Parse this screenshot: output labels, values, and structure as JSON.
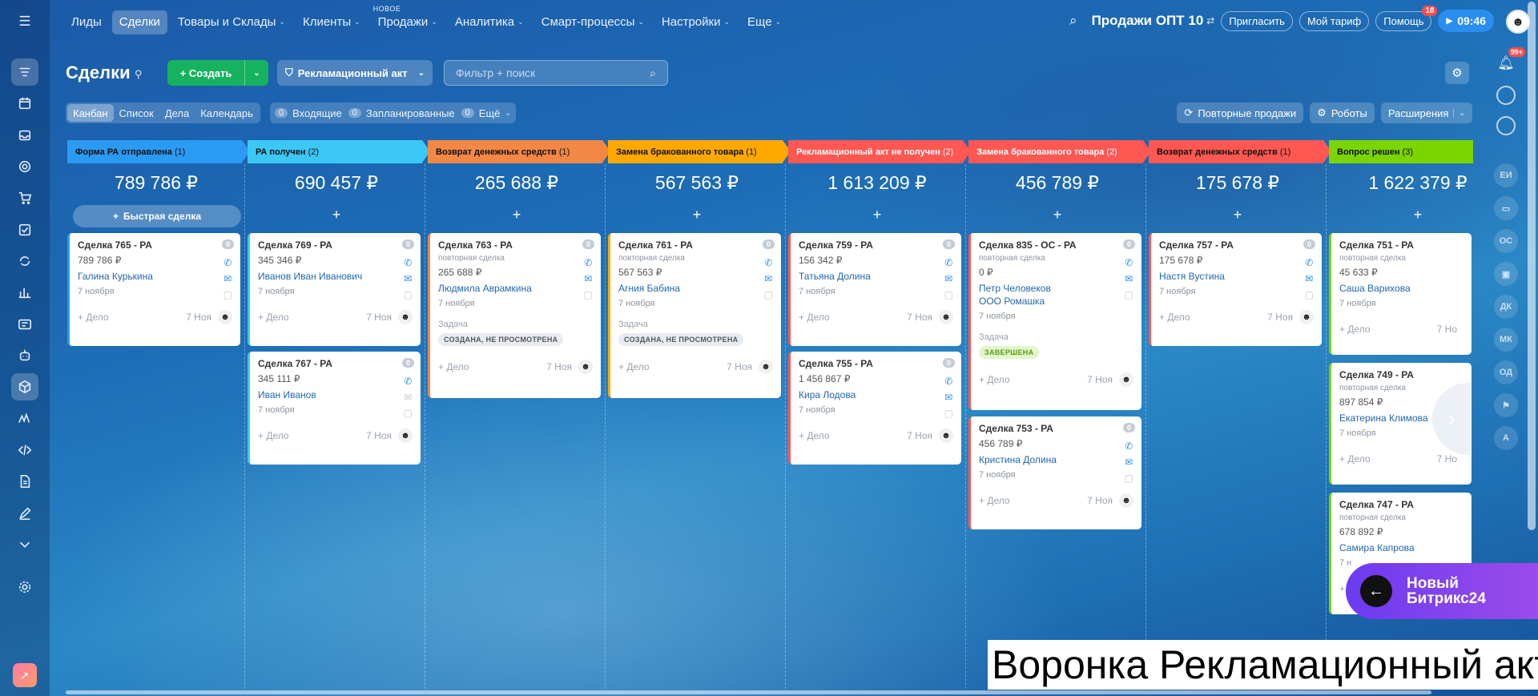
{
  "topnav": {
    "items": [
      {
        "label": "Лиды",
        "active": false,
        "chev": ""
      },
      {
        "label": "Сделки",
        "active": true,
        "chev": ""
      },
      {
        "label": "Товары и Склады",
        "active": false,
        "chev": "⌄"
      },
      {
        "label": "Клиенты",
        "active": false,
        "chev": "⌄"
      },
      {
        "label": "Продажи",
        "active": false,
        "chev": "⌄",
        "tag": "НОВОЕ"
      },
      {
        "label": "Аналитика",
        "active": false,
        "chev": "⌄"
      },
      {
        "label": "Смарт-процессы",
        "active": false,
        "chev": "⌄"
      },
      {
        "label": "Настройки",
        "active": false,
        "chev": "⌄"
      },
      {
        "label": "Еще",
        "active": false,
        "chev": "⌄"
      }
    ],
    "portal_name": "Продажи ОПТ 10",
    "invite_label": "Пригласить",
    "tariff_label": "Мой тариф",
    "help_label": "Помощь",
    "help_badge": "18",
    "time": "09:46"
  },
  "toolbar": {
    "title": "Сделки",
    "create_label": "Создать",
    "funnel_label": "Рекламационный акт",
    "search_placeholder": "Фильтр + поиск"
  },
  "views": {
    "tabs": [
      "Канбан",
      "Список",
      "Дела",
      "Календарь"
    ],
    "counters": [
      {
        "num": "0",
        "label": "Входящие"
      },
      {
        "num": "0",
        "label": "Запланированные"
      },
      {
        "num": "0",
        "label": "Ещё"
      }
    ],
    "repeat_sales": "Повторные продажи",
    "robots": "Роботы",
    "extensions": "Расширения"
  },
  "quick_deal_label": "Быстрая сделка",
  "stages": [
    {
      "name": "Форма РА отправлена",
      "count": "(1)",
      "sum": "789 786 ₽",
      "color": "#2b9af3",
      "text": "#111"
    },
    {
      "name": "РА получен",
      "count": "(2)",
      "sum": "690 457 ₽",
      "color": "#3bc8f5",
      "text": "#111"
    },
    {
      "name": "Возврат денежных средств",
      "count": "(1)",
      "sum": "265 688 ₽",
      "color": "#f28746",
      "text": "#111"
    },
    {
      "name": "Замена бракованного товара",
      "count": "(1)",
      "sum": "567 563 ₽",
      "color": "#ffa900",
      "text": "#111"
    },
    {
      "name": "Рекламационный акт не получен",
      "count": "(2)",
      "sum": "1 613 209 ₽",
      "color": "#ff5752",
      "text": "#fff"
    },
    {
      "name": "Замена бракованного товара",
      "count": "(2)",
      "sum": "456 789 ₽",
      "color": "#ff5752",
      "text": "#fff"
    },
    {
      "name": "Возврат денежных средств",
      "count": "(1)",
      "sum": "175 678 ₽",
      "color": "#ff5752",
      "text": "#111"
    },
    {
      "name": "Вопрос решен",
      "count": "(3)",
      "sum": "1 622 379 ₽",
      "color": "#7bd500",
      "text": "#111"
    }
  ],
  "cards": [
    {
      "title": "Сделка 765 - РА",
      "sub": "",
      "amount": "789 786 ₽",
      "contacts": [
        "Галина Курькина"
      ],
      "date": "7 ноября",
      "task_label": "",
      "task": "",
      "add": "+ Дело",
      "fdate": "7 Ноя",
      "badge": "0"
    },
    {
      "title": "Сделка 769 - РА",
      "sub": "",
      "amount": "345 346 ₽",
      "contacts": [
        "Иванов Иван Иванович"
      ],
      "date": "7 ноября",
      "task_label": "",
      "task": "",
      "add": "+ Дело",
      "fdate": "7 Ноя",
      "badge": "0"
    },
    {
      "title": "Сделка 767 - РА",
      "sub": "",
      "amount": "345 111 ₽",
      "contacts": [
        "Иван Иванов"
      ],
      "date": "7 ноября",
      "task_label": "",
      "task": "",
      "add": "+ Дело",
      "fdate": "7 Ноя",
      "badge": "0"
    },
    {
      "title": "Сделка 763 - РА",
      "sub": "повторная сделка",
      "amount": "265 688 ₽",
      "contacts": [
        "Людмила Аврамкина"
      ],
      "date": "7 ноября",
      "task_label": "Задача",
      "task": "СОЗДАНА, НЕ ПРОСМОТРЕНА",
      "add": "+ Дело",
      "fdate": "7 Ноя",
      "badge": "0"
    },
    {
      "title": "Сделка 761 - РА",
      "sub": "повторная сделка",
      "amount": "567 563 ₽",
      "contacts": [
        "Агния Бабина"
      ],
      "date": "7 ноября",
      "task_label": "Задача",
      "task": "СОЗДАНА, НЕ ПРОСМОТРЕНА",
      "add": "+ Дело",
      "fdate": "7 Ноя",
      "badge": "0"
    },
    {
      "title": "Сделка 759 - РА",
      "sub": "",
      "amount": "156 342 ₽",
      "contacts": [
        "Татьяна Долина"
      ],
      "date": "7 ноября",
      "task_label": "",
      "task": "",
      "add": "+ Дело",
      "fdate": "7 Ноя",
      "badge": "0"
    },
    {
      "title": "Сделка 755 - РА",
      "sub": "",
      "amount": "1 456 867 ₽",
      "contacts": [
        "Кира Лодова"
      ],
      "date": "7 ноября",
      "task_label": "",
      "task": "",
      "add": "+ Дело",
      "fdate": "7 Ноя",
      "badge": "0"
    },
    {
      "title": "Сделка 835 - ОС - РА",
      "sub": "повторная сделка",
      "amount": "0 ₽",
      "contacts": [
        "Петр Человеков",
        "ООО Ромашка"
      ],
      "date": "7 ноября",
      "task_label": "Задача",
      "task": "ЗАВЕРШЕНА",
      "add": "+ Дело",
      "fdate": "7 Ноя",
      "badge": "0"
    },
    {
      "title": "Сделка 753 - РА",
      "sub": "",
      "amount": "456 789 ₽",
      "contacts": [
        "Кристина Долина"
      ],
      "date": "7 ноября",
      "task_label": "",
      "task": "",
      "add": "+ Дело",
      "fdate": "7 Ноя",
      "badge": "0"
    },
    {
      "title": "Сделка 757 - РА",
      "sub": "",
      "amount": "175 678 ₽",
      "contacts": [
        "Настя Вустина"
      ],
      "date": "7 ноября",
      "task_label": "",
      "task": "",
      "add": "+ Дело",
      "fdate": "7 Ноя",
      "badge": "0"
    },
    {
      "title": "Сделка 751 - РА",
      "sub": "повторная сделка",
      "amount": "45 633 ₽",
      "contacts": [
        "Саша Варихова"
      ],
      "date": "7 ноября",
      "task_label": "",
      "task": "",
      "add": "+ Дело",
      "fdate": "7 Но",
      "badge": ""
    },
    {
      "title": "Сделка 749 - РА",
      "sub": "повторная сделка",
      "amount": "897 854 ₽",
      "contacts": [
        "Екатерина Климова"
      ],
      "date": "7 ноября",
      "task_label": "",
      "task": "",
      "add": "+ Дело",
      "fdate": "7 Но",
      "badge": ""
    },
    {
      "title": "Сделка 747 - РА",
      "sub": "повторная сделка",
      "amount": "678 892 ₽",
      "contacts": [
        "Самира Капрова"
      ],
      "date": "7 н",
      "task_label": "",
      "task": "",
      "add": "+",
      "fdate": "",
      "badge": ""
    }
  ],
  "right_panel": [
    "ЕИ",
    "ОС",
    "ДК",
    "МК",
    "ОД",
    "А"
  ],
  "notifications_badge": "99+",
  "promo_text": "Новый Битрикс24",
  "caption": "Воронка Рекламационный акт"
}
